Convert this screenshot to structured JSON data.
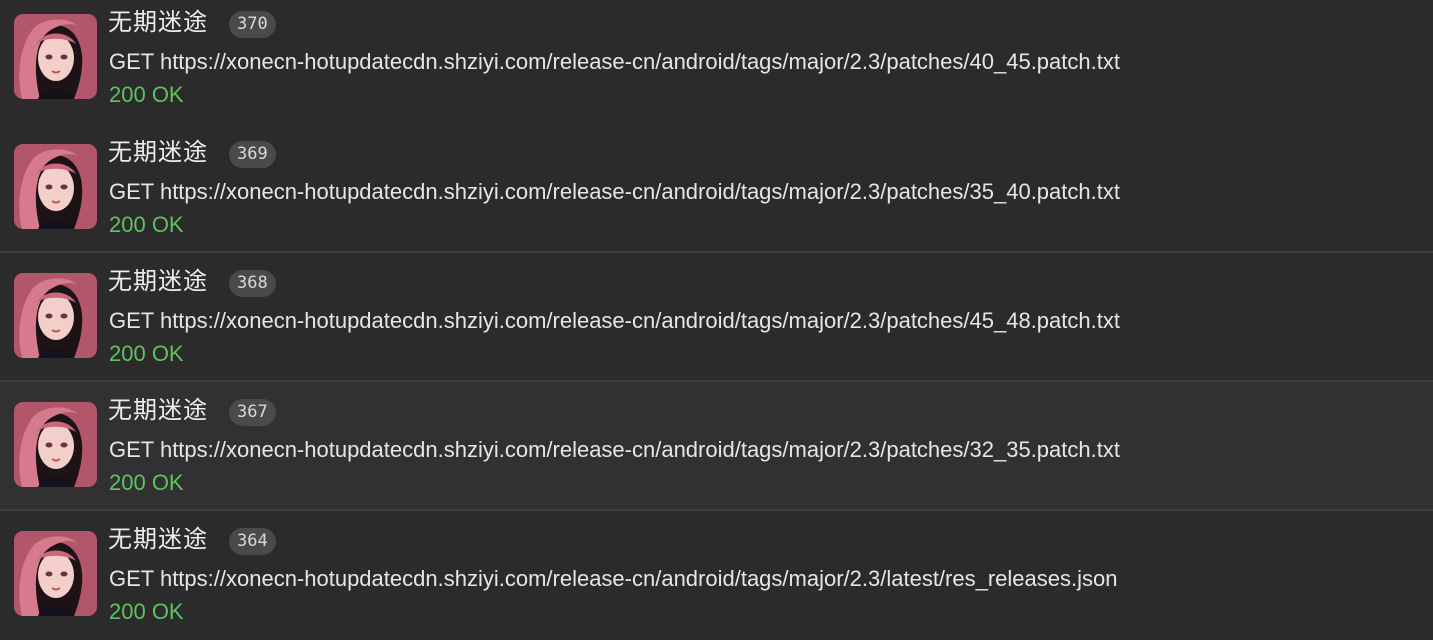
{
  "requests": [
    {
      "app_name": "无期迷途",
      "id": "370",
      "method": "GET",
      "url": "https://xonecn-hotupdatecdn.shziyi.com/release-cn/android/tags/major/2.3/patches/40_45.patch.txt",
      "status": "200 OK"
    },
    {
      "app_name": "无期迷途",
      "id": "369",
      "method": "GET",
      "url": "https://xonecn-hotupdatecdn.shziyi.com/release-cn/android/tags/major/2.3/patches/35_40.patch.txt",
      "status": "200 OK"
    },
    {
      "app_name": "无期迷途",
      "id": "368",
      "method": "GET",
      "url": "https://xonecn-hotupdatecdn.shziyi.com/release-cn/android/tags/major/2.3/patches/45_48.patch.txt",
      "status": "200 OK"
    },
    {
      "app_name": "无期迷途",
      "id": "367",
      "method": "GET",
      "url": "https://xonecn-hotupdatecdn.shziyi.com/release-cn/android/tags/major/2.3/patches/32_35.patch.txt",
      "status": "200 OK"
    },
    {
      "app_name": "无期迷途",
      "id": "364",
      "method": "GET",
      "url": "https://xonecn-hotupdatecdn.shziyi.com/release-cn/android/tags/major/2.3/latest/res_releases.json",
      "status": "200 OK"
    }
  ],
  "colors": {
    "background": "#2b2b2c",
    "selected_row": "#313133",
    "divider": "#3d3d3f",
    "status_ok": "#5fc25f",
    "badge_bg": "#4a4a4c"
  },
  "icons": {
    "app_avatar": "app-icon-anime-character-portrait"
  }
}
